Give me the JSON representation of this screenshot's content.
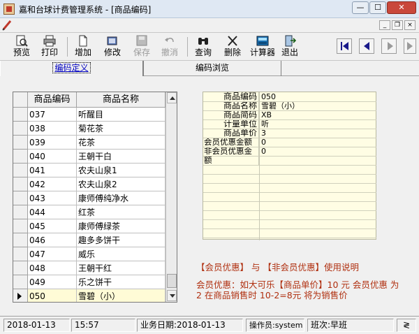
{
  "window": {
    "title": "嘉和台球计费管理系统 - [商品编码]",
    "controls": {
      "minimize": "—",
      "maximize": "☐",
      "close": "✕"
    },
    "mdi_controls": {
      "minimize": "_",
      "restore": "❐",
      "close": "×"
    }
  },
  "toolbar": {
    "preview": "预览",
    "print": "打印",
    "add": "增加",
    "edit": "修改",
    "save": "保存",
    "undo": "撤消",
    "query": "查询",
    "delete": "删除",
    "calculator": "计算器",
    "exit": "退出"
  },
  "tabs": [
    {
      "label": "编码定义",
      "active": true
    },
    {
      "label": "编码浏览",
      "active": false
    }
  ],
  "grid": {
    "columns": [
      "商品编码",
      "商品名称"
    ],
    "rows": [
      {
        "code": "037",
        "name": "听醒目"
      },
      {
        "code": "038",
        "name": "菊花茶"
      },
      {
        "code": "039",
        "name": "花茶"
      },
      {
        "code": "040",
        "name": "王朝干白"
      },
      {
        "code": "041",
        "name": "农夫山泉1"
      },
      {
        "code": "042",
        "name": "农夫山泉2"
      },
      {
        "code": "043",
        "name": "康师傅纯净水"
      },
      {
        "code": "044",
        "name": "红茶"
      },
      {
        "code": "045",
        "name": "康师傅绿茶"
      },
      {
        "code": "046",
        "name": "趣多多饼干"
      },
      {
        "code": "047",
        "name": "威乐"
      },
      {
        "code": "048",
        "name": "王朝干红"
      },
      {
        "code": "049",
        "name": "乐之饼干"
      },
      {
        "code": "050",
        "name": "雪碧（小）"
      }
    ],
    "current_row": 13
  },
  "detail": {
    "fields": [
      {
        "label": "商品编码",
        "value": "050"
      },
      {
        "label": "商品名称",
        "value": "雪碧（小）"
      },
      {
        "label": "商品简码",
        "value": "XB"
      },
      {
        "label": "计量单位",
        "value": "听"
      },
      {
        "label": "商品单价",
        "value": "3"
      },
      {
        "label": "会员优惠金额",
        "value": "0"
      },
      {
        "label": "非会员优惠金",
        "value": "0"
      },
      {
        "label": "额",
        "value": ""
      }
    ]
  },
  "notes": {
    "title": "【会员优惠】 与 【非会员优惠】使用说明",
    "body": "会员优惠：如大可乐【商品单价】10 元 会员优惠 为 2 在商品销售时 10-2=8元 将为销售价"
  },
  "status": {
    "date": "2018-01-13",
    "time": "15:57",
    "business_date": "业务日期:2018-01-13",
    "operator": "操作员:system",
    "shift": "班次:早班"
  },
  "colors": {
    "accent": "#0000c0",
    "note_text": "#b03010",
    "detail_bg": "#fffde4",
    "grid_current": "#fffbd6"
  }
}
